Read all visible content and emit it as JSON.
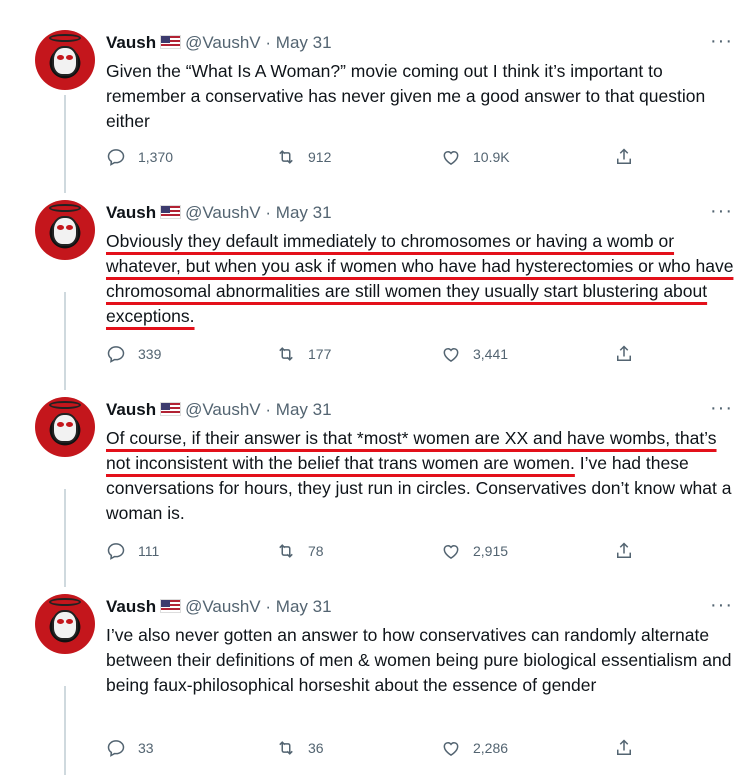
{
  "tweets": [
    {
      "author": "Vaush",
      "handle": "@VaushV",
      "date": "May 31",
      "text_segments": [
        {
          "t": "Given the “What Is A Woman?” movie coming out I think it’s important to remember a conservative has never given me a good answer to that question either",
          "hl": false
        }
      ],
      "replies": "1,370",
      "retweets": "912",
      "likes": "10.9K"
    },
    {
      "author": "Vaush",
      "handle": "@VaushV",
      "date": "May 31",
      "text_segments": [
        {
          "t": "Obviously they default immediately to chromosomes or having a womb or whatever, but when you ask if women who have had hysterectomies or who have chromosomal abnormalities are still women they usually start blustering about exceptions.",
          "hl": true
        }
      ],
      "replies": "339",
      "retweets": "177",
      "likes": "3,441"
    },
    {
      "author": "Vaush",
      "handle": "@VaushV",
      "date": "May 31",
      "text_segments": [
        {
          "t": "Of course, if their answer is that *most* women are XX and have wombs, that’s not inconsistent with the belief that trans women are women.",
          "hl": true
        },
        {
          "t": " I’ve had these conversations for hours, they just run in circles. Conservatives don’t know what a woman is.",
          "hl": false
        }
      ],
      "replies": "111",
      "retweets": "78",
      "likes": "2,915"
    },
    {
      "author": "Vaush",
      "handle": "@VaushV",
      "date": "May 31",
      "text_segments": [
        {
          "t": "I’ve also never gotten an answer to how conservatives can randomly alternate between their definitions of men & women being pure biological essentialism and being faux-philosophical horseshit about the essence of gender",
          "hl": false
        }
      ],
      "replies": "33",
      "retweets": "36",
      "likes": "2,286"
    }
  ],
  "separator": "·",
  "more_label": "···",
  "icons": {
    "reply": "reply-icon",
    "retweet": "retweet-icon",
    "like": "heart-icon",
    "share": "share-icon",
    "flag": "us-flag-icon"
  },
  "colors": {
    "text": "#0f1419",
    "muted": "#536471",
    "underline": "#e3101a",
    "thread": "#cfd9de"
  }
}
